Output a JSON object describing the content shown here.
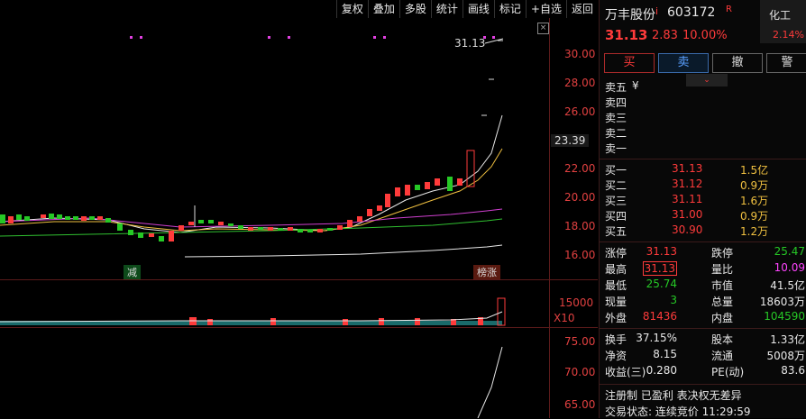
{
  "toolbar": {
    "items": [
      "复权",
      "叠加",
      "多股",
      "统计",
      "画线",
      "标记",
      "+自选",
      "返回"
    ]
  },
  "chart": {
    "price_axis": [
      "30.00",
      "28.00",
      "26.00",
      "24.00",
      "22.00",
      "20.00",
      "18.00",
      "16.00"
    ],
    "current_price_tag": "23.39",
    "high_annotation": "31.13",
    "volume_axis": "15000",
    "volume_unit": "X10",
    "indicator_axis": [
      "75.00",
      "70.00",
      "65.00"
    ],
    "marker_jian": "减",
    "marker_bangzhang": "榜涨"
  },
  "stock": {
    "name": "万丰股份",
    "name_suffix": "i",
    "code": "603172",
    "code_flag": "R",
    "sector": "化工",
    "sector_change": "2.14%",
    "price": "31.13",
    "change": "2.83",
    "change_pct": "10.00%"
  },
  "buttons": {
    "buy": "买",
    "sell": "卖",
    "cancel": "撤",
    "alert": "警"
  },
  "order_book": {
    "sell": [
      {
        "label": "卖五",
        "price": "¥",
        "vol": ""
      },
      {
        "label": "卖四",
        "price": "",
        "vol": ""
      },
      {
        "label": "卖三",
        "price": "",
        "vol": ""
      },
      {
        "label": "卖二",
        "price": "",
        "vol": ""
      },
      {
        "label": "卖一",
        "price": "",
        "vol": ""
      }
    ],
    "buy": [
      {
        "label": "买一",
        "price": "31.13",
        "vol": "1.5亿"
      },
      {
        "label": "买二",
        "price": "31.12",
        "vol": "0.9万"
      },
      {
        "label": "买三",
        "price": "31.11",
        "vol": "1.6万"
      },
      {
        "label": "买四",
        "price": "31.00",
        "vol": "0.9万"
      },
      {
        "label": "买五",
        "price": "30.90",
        "vol": "1.2万"
      }
    ]
  },
  "stats": [
    {
      "l1": "涨停",
      "v1": "31.13",
      "l2": "跌停",
      "v2": "25.47"
    },
    {
      "l1": "最高",
      "v1": "31.13",
      "l2": "量比",
      "v2": "10.09"
    },
    {
      "l1": "最低",
      "v1": "25.74",
      "l2": "市值",
      "v2": "41.5亿"
    },
    {
      "l1": "现量",
      "v1": "3",
      "l2": "总量",
      "v2": "18603万"
    },
    {
      "l1": "外盘",
      "v1": "81436",
      "l2": "内盘",
      "v2": "104590"
    }
  ],
  "fund": [
    {
      "l1": "换手",
      "v1": "37.15%",
      "l2": "股本",
      "v2": "1.33亿"
    },
    {
      "l1": "净资",
      "v1": "8.15",
      "l2": "流通",
      "v2": "5008万"
    },
    {
      "l1": "收益(三)",
      "v1": "0.280",
      "l2": "PE(动)",
      "v2": "83.6"
    }
  ],
  "tags": "注册制 已盈利 表决权无差异",
  "trade_status": "交易状态: 连续竞价 11:29:59",
  "colors": {
    "up": "#ff3b3b",
    "down": "#26c926",
    "ma_white": "#e8e8e8",
    "ma_yellow": "#f0c040",
    "ma_magenta": "#d040d0",
    "ma_green": "#30c030"
  }
}
